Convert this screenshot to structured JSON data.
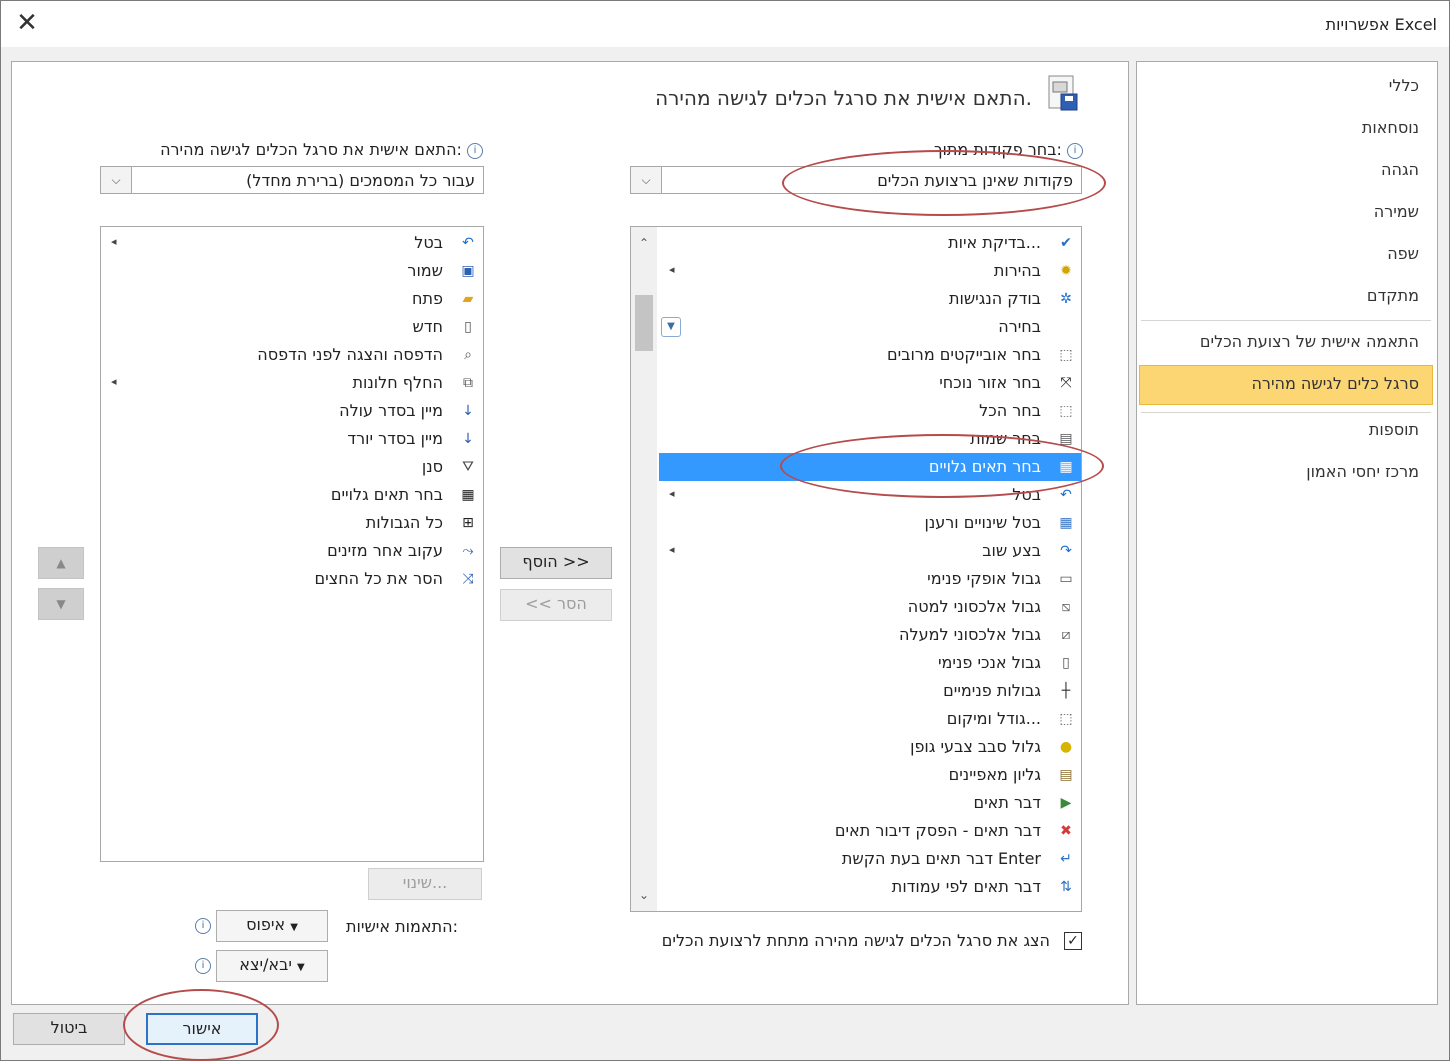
{
  "window": {
    "title": "אפשרויות Excel",
    "close_glyph": "✕"
  },
  "nav": {
    "items": [
      {
        "label": "כללי"
      },
      {
        "label": "נוסחאות"
      },
      {
        "label": "הגהה"
      },
      {
        "label": "שמירה"
      },
      {
        "label": "שפה"
      },
      {
        "label": "מתקדם"
      },
      {
        "label": "התאמה אישית של רצועת הכלים"
      },
      {
        "label": "סרגל כלים לגישה מהירה"
      },
      {
        "label": "תוספות"
      },
      {
        "label": "מרכז יחסי האמון"
      }
    ],
    "active_index": 7
  },
  "main": {
    "heading": "התאם אישית את סרגל הכלים לגישה מהירה.",
    "choose_label": "בחר פקודות מתוך:",
    "choose_value": "פקודות שאינן ברצועת הכלים",
    "customize_label": "התאם אישית את סרגל הכלים לגישה מהירה:",
    "customize_value": "עבור כל המסמכים (ברירת מחדל)",
    "info_glyph": "i",
    "dropdown_glyph": "⌵",
    "commands": [
      {
        "label": "בדיקת איות...",
        "icon": "spellcheck-icon",
        "glyph": "✔",
        "color": "#2b6cc4",
        "arrow": false
      },
      {
        "label": "בהירות",
        "icon": "brightness-icon",
        "glyph": "✹",
        "color": "#d2a400",
        "arrow": true
      },
      {
        "label": "בודק הנגישות",
        "icon": "accessibility-icon",
        "glyph": "✲",
        "color": "#1e6fd0",
        "arrow": false
      },
      {
        "label": "בחירה",
        "icon": "selection-icon",
        "glyph": "",
        "color": "#444",
        "arrow": false,
        "dropdown": true
      },
      {
        "label": "בחר אובייקטים מרובים",
        "icon": "select-objects-icon",
        "glyph": "⬚",
        "color": "#555",
        "arrow": false
      },
      {
        "label": "בחר אזור נוכחי",
        "icon": "current-region-icon",
        "glyph": "⤧",
        "color": "#222",
        "arrow": false
      },
      {
        "label": "בחר הכל",
        "icon": "select-all-icon",
        "glyph": "⬚",
        "color": "#666",
        "arrow": false
      },
      {
        "label": "בחר שמות",
        "icon": "select-names-icon",
        "glyph": "▤",
        "color": "#555",
        "arrow": false
      },
      {
        "label": "בחר תאים גלויים",
        "icon": "visible-cells-icon",
        "glyph": "▦",
        "color": "#222",
        "arrow": false
      },
      {
        "label": "בטל",
        "icon": "undo-icon",
        "glyph": "↶",
        "color": "#1e6fd0",
        "arrow": true
      },
      {
        "label": "בטל שינויים ורענן",
        "icon": "discard-refresh-icon",
        "glyph": "▦",
        "color": "#3b76c4",
        "arrow": false
      },
      {
        "label": "בצע שוב",
        "icon": "redo-icon",
        "glyph": "↷",
        "color": "#1e6fd0",
        "arrow": true
      },
      {
        "label": "גבול אופקי פנימי",
        "icon": "inside-horizontal-border-icon",
        "glyph": "▭",
        "color": "#555",
        "arrow": false
      },
      {
        "label": "גבול אלכסוני למטה",
        "icon": "diagonal-down-border-icon",
        "glyph": "⧅",
        "color": "#555",
        "arrow": false
      },
      {
        "label": "גבול אלכסוני למעלה",
        "icon": "diagonal-up-border-icon",
        "glyph": "⧄",
        "color": "#555",
        "arrow": false
      },
      {
        "label": "גבול אנכי פנימי",
        "icon": "inside-vertical-border-icon",
        "glyph": "▯",
        "color": "#555",
        "arrow": false
      },
      {
        "label": "גבולות פנימיים",
        "icon": "inside-borders-icon",
        "glyph": "┼",
        "color": "#333",
        "arrow": false
      },
      {
        "label": "גודל ומיקום...",
        "icon": "size-position-icon",
        "glyph": "⬚",
        "color": "#555",
        "arrow": false
      },
      {
        "label": "גלול סבב צבעי גופן",
        "icon": "font-color-cycle-icon",
        "glyph": "●",
        "color": "#d6b400",
        "arrow": false
      },
      {
        "label": "גליון מאפיינים",
        "icon": "property-sheet-icon",
        "glyph": "▤",
        "color": "#8a6d2f",
        "arrow": false
      },
      {
        "label": "דבר תאים",
        "icon": "speak-cells-icon",
        "glyph": "▶",
        "color": "#3a8a3a",
        "arrow": false
      },
      {
        "label": "דבר תאים - הפסק דיבור תאים",
        "icon": "stop-speaking-icon",
        "glyph": "✖",
        "color": "#d23b3b",
        "arrow": false
      },
      {
        "label": "דבר תאים בעת הקשת Enter",
        "icon": "speak-on-enter-icon",
        "glyph": "↵",
        "color": "#2f6fc4",
        "arrow": false
      },
      {
        "label": "דבר תאים לפי עמודות",
        "icon": "speak-by-columns-icon",
        "glyph": "⇅",
        "color": "#2f6fc4",
        "arrow": false
      }
    ],
    "selected_command_index": 8,
    "qat_items": [
      {
        "label": "בטל",
        "icon": "undo-icon",
        "glyph": "↶",
        "color": "#1e6fd0",
        "arrow": true
      },
      {
        "label": "שמור",
        "icon": "save-icon",
        "glyph": "▣",
        "color": "#2f5fb3",
        "arrow": false
      },
      {
        "label": "פתח",
        "icon": "open-folder-icon",
        "glyph": "▰",
        "color": "#e0a521",
        "arrow": false
      },
      {
        "label": "חדש",
        "icon": "new-document-icon",
        "glyph": "▯",
        "color": "#555",
        "arrow": false
      },
      {
        "label": "הדפסה והצגה לפני הדפסה",
        "icon": "print-preview-icon",
        "glyph": "⌕",
        "color": "#555",
        "arrow": false
      },
      {
        "label": "החלף חלונות",
        "icon": "switch-windows-icon",
        "glyph": "⧉",
        "color": "#555",
        "arrow": true
      },
      {
        "label": "מיין בסדר עולה",
        "icon": "sort-ascending-icon",
        "glyph": "↓",
        "color": "#2f5fb3",
        "arrow": false
      },
      {
        "label": "מיין בסדר יורד",
        "icon": "sort-descending-icon",
        "glyph": "↓",
        "color": "#2f5fb3",
        "arrow": false
      },
      {
        "label": "סנן",
        "icon": "filter-icon",
        "glyph": "⛛",
        "color": "#444",
        "arrow": false
      },
      {
        "label": "בחר תאים גלויים",
        "icon": "visible-cells-icon",
        "glyph": "▦",
        "color": "#222",
        "arrow": false
      },
      {
        "label": "כל הגבולות",
        "icon": "all-borders-icon",
        "glyph": "⊞",
        "color": "#222",
        "arrow": false
      },
      {
        "label": "עקוב אחר מזינים",
        "icon": "trace-precedents-icon",
        "glyph": "⤳",
        "color": "#2f5fb3",
        "arrow": false
      },
      {
        "label": "הסר את כל החצים",
        "icon": "remove-arrows-icon",
        "glyph": "⤨",
        "color": "#2f5fb3",
        "arrow": false
      }
    ],
    "add_button": "הוסף >>",
    "remove_button": "<< הסר",
    "modify_button": "שינוי...",
    "move_up_glyph": "▲",
    "move_down_glyph": "▼",
    "customizations_label": "התאמות אישיות:",
    "reset_button": "איפוס",
    "import_export_button": "יבא/יצא",
    "scroll_up_glyph": "⌃",
    "scroll_down_glyph": "⌄",
    "show_below_label": "הצג את סרגל הכלים לגישה מהירה מתחת לרצועת הכלים",
    "show_below_checked": true,
    "check_glyph": "✓",
    "arrow_glyph": "◂"
  },
  "footer": {
    "ok_button": "אישור",
    "cancel_button": "ביטול"
  }
}
